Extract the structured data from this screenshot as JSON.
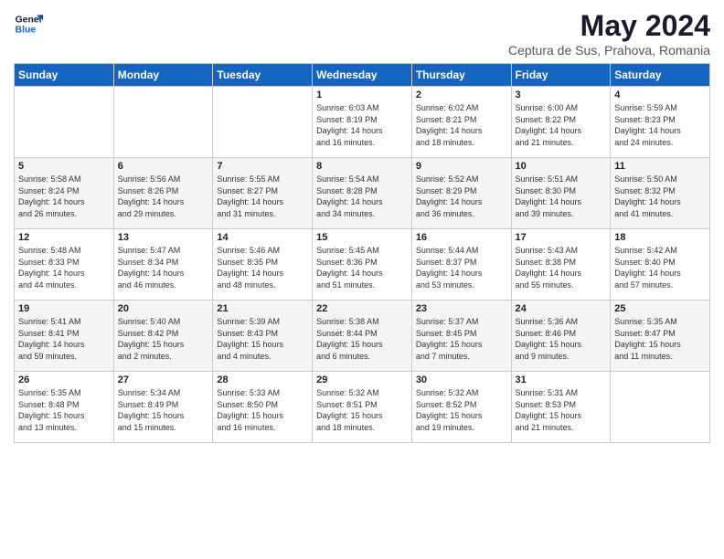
{
  "header": {
    "logo_line1": "General",
    "logo_line2": "Blue",
    "month": "May 2024",
    "location": "Ceptura de Sus, Prahova, Romania"
  },
  "weekdays": [
    "Sunday",
    "Monday",
    "Tuesday",
    "Wednesday",
    "Thursday",
    "Friday",
    "Saturday"
  ],
  "weeks": [
    [
      {
        "day": "",
        "info": ""
      },
      {
        "day": "",
        "info": ""
      },
      {
        "day": "",
        "info": ""
      },
      {
        "day": "1",
        "info": "Sunrise: 6:03 AM\nSunset: 8:19 PM\nDaylight: 14 hours\nand 16 minutes."
      },
      {
        "day": "2",
        "info": "Sunrise: 6:02 AM\nSunset: 8:21 PM\nDaylight: 14 hours\nand 18 minutes."
      },
      {
        "day": "3",
        "info": "Sunrise: 6:00 AM\nSunset: 8:22 PM\nDaylight: 14 hours\nand 21 minutes."
      },
      {
        "day": "4",
        "info": "Sunrise: 5:59 AM\nSunset: 8:23 PM\nDaylight: 14 hours\nand 24 minutes."
      }
    ],
    [
      {
        "day": "5",
        "info": "Sunrise: 5:58 AM\nSunset: 8:24 PM\nDaylight: 14 hours\nand 26 minutes."
      },
      {
        "day": "6",
        "info": "Sunrise: 5:56 AM\nSunset: 8:26 PM\nDaylight: 14 hours\nand 29 minutes."
      },
      {
        "day": "7",
        "info": "Sunrise: 5:55 AM\nSunset: 8:27 PM\nDaylight: 14 hours\nand 31 minutes."
      },
      {
        "day": "8",
        "info": "Sunrise: 5:54 AM\nSunset: 8:28 PM\nDaylight: 14 hours\nand 34 minutes."
      },
      {
        "day": "9",
        "info": "Sunrise: 5:52 AM\nSunset: 8:29 PM\nDaylight: 14 hours\nand 36 minutes."
      },
      {
        "day": "10",
        "info": "Sunrise: 5:51 AM\nSunset: 8:30 PM\nDaylight: 14 hours\nand 39 minutes."
      },
      {
        "day": "11",
        "info": "Sunrise: 5:50 AM\nSunset: 8:32 PM\nDaylight: 14 hours\nand 41 minutes."
      }
    ],
    [
      {
        "day": "12",
        "info": "Sunrise: 5:48 AM\nSunset: 8:33 PM\nDaylight: 14 hours\nand 44 minutes."
      },
      {
        "day": "13",
        "info": "Sunrise: 5:47 AM\nSunset: 8:34 PM\nDaylight: 14 hours\nand 46 minutes."
      },
      {
        "day": "14",
        "info": "Sunrise: 5:46 AM\nSunset: 8:35 PM\nDaylight: 14 hours\nand 48 minutes."
      },
      {
        "day": "15",
        "info": "Sunrise: 5:45 AM\nSunset: 8:36 PM\nDaylight: 14 hours\nand 51 minutes."
      },
      {
        "day": "16",
        "info": "Sunrise: 5:44 AM\nSunset: 8:37 PM\nDaylight: 14 hours\nand 53 minutes."
      },
      {
        "day": "17",
        "info": "Sunrise: 5:43 AM\nSunset: 8:38 PM\nDaylight: 14 hours\nand 55 minutes."
      },
      {
        "day": "18",
        "info": "Sunrise: 5:42 AM\nSunset: 8:40 PM\nDaylight: 14 hours\nand 57 minutes."
      }
    ],
    [
      {
        "day": "19",
        "info": "Sunrise: 5:41 AM\nSunset: 8:41 PM\nDaylight: 14 hours\nand 59 minutes."
      },
      {
        "day": "20",
        "info": "Sunrise: 5:40 AM\nSunset: 8:42 PM\nDaylight: 15 hours\nand 2 minutes."
      },
      {
        "day": "21",
        "info": "Sunrise: 5:39 AM\nSunset: 8:43 PM\nDaylight: 15 hours\nand 4 minutes."
      },
      {
        "day": "22",
        "info": "Sunrise: 5:38 AM\nSunset: 8:44 PM\nDaylight: 15 hours\nand 6 minutes."
      },
      {
        "day": "23",
        "info": "Sunrise: 5:37 AM\nSunset: 8:45 PM\nDaylight: 15 hours\nand 7 minutes."
      },
      {
        "day": "24",
        "info": "Sunrise: 5:36 AM\nSunset: 8:46 PM\nDaylight: 15 hours\nand 9 minutes."
      },
      {
        "day": "25",
        "info": "Sunrise: 5:35 AM\nSunset: 8:47 PM\nDaylight: 15 hours\nand 11 minutes."
      }
    ],
    [
      {
        "day": "26",
        "info": "Sunrise: 5:35 AM\nSunset: 8:48 PM\nDaylight: 15 hours\nand 13 minutes."
      },
      {
        "day": "27",
        "info": "Sunrise: 5:34 AM\nSunset: 8:49 PM\nDaylight: 15 hours\nand 15 minutes."
      },
      {
        "day": "28",
        "info": "Sunrise: 5:33 AM\nSunset: 8:50 PM\nDaylight: 15 hours\nand 16 minutes."
      },
      {
        "day": "29",
        "info": "Sunrise: 5:32 AM\nSunset: 8:51 PM\nDaylight: 15 hours\nand 18 minutes."
      },
      {
        "day": "30",
        "info": "Sunrise: 5:32 AM\nSunset: 8:52 PM\nDaylight: 15 hours\nand 19 minutes."
      },
      {
        "day": "31",
        "info": "Sunrise: 5:31 AM\nSunset: 8:53 PM\nDaylight: 15 hours\nand 21 minutes."
      },
      {
        "day": "",
        "info": ""
      }
    ]
  ]
}
